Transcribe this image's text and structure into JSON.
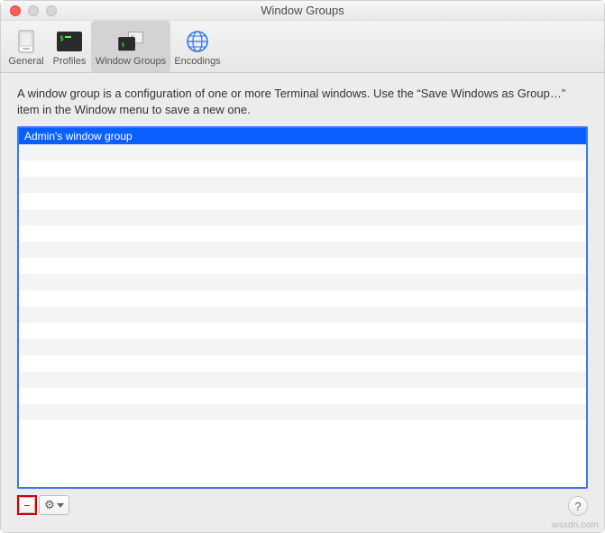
{
  "window": {
    "title": "Window Groups"
  },
  "toolbar": {
    "items": [
      {
        "label": "General"
      },
      {
        "label": "Profiles"
      },
      {
        "label": "Window Groups"
      },
      {
        "label": "Encodings"
      }
    ]
  },
  "description": "A window group is a configuration of one or more Terminal windows. Use the “Save Windows as Group…” item in the Window menu to save a new one.",
  "list": {
    "items": [
      {
        "label": "Admin's window group",
        "selected": true
      }
    ],
    "visible_row_count": 19
  },
  "footer": {
    "remove_label": "−",
    "gear_label": "⚙",
    "help_label": "?"
  },
  "watermark": "wsxdn.com"
}
